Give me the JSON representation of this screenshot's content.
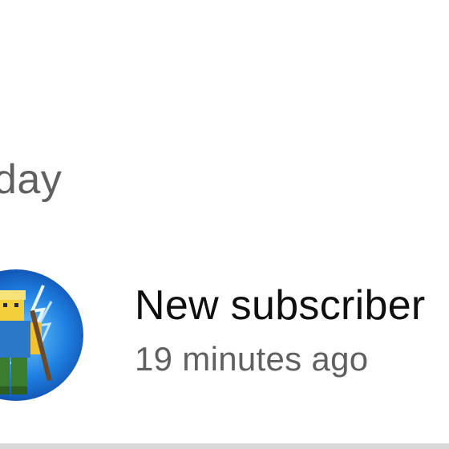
{
  "section": {
    "header": "day"
  },
  "notification": {
    "title": "New subscriber",
    "time": "19 minutes ago",
    "avatar_icon": "channel-avatar-icon"
  },
  "colors": {
    "background": "#ffffff",
    "primary_text": "#0f0f0f",
    "secondary_text": "#606060",
    "avatar_bg": "#1a73e8"
  }
}
